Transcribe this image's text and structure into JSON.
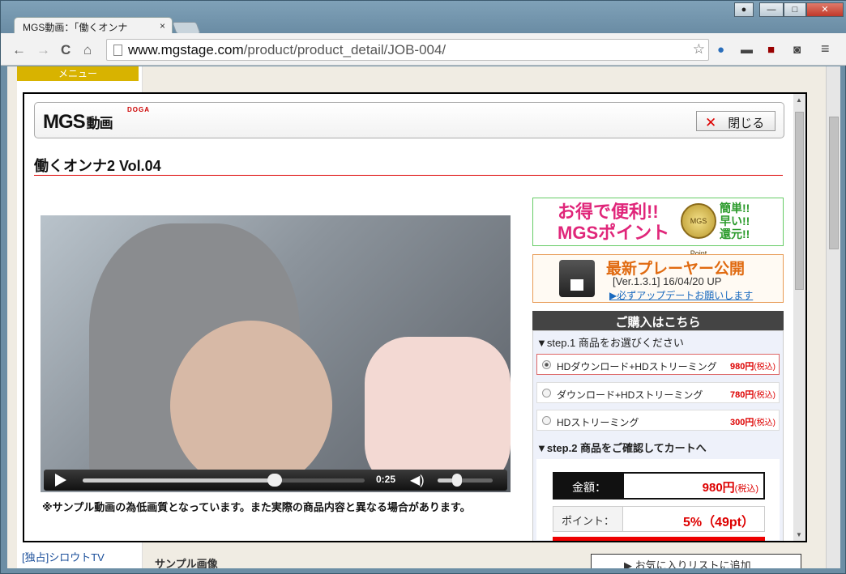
{
  "browser": {
    "tab_title": "MGS動画：「働くオンナ",
    "tab_close": "×",
    "url_host": "www.mgstage.com",
    "url_path": "/product/product_detail/JOB-004/",
    "back": "←",
    "forward": "→",
    "reload": "C",
    "home": "⌂",
    "minimize": "—",
    "maximize": "□",
    "close": "✕",
    "menu": "≡"
  },
  "background_page": {
    "menu_label": "メニュー",
    "sidebar_link": "[独占]シロウトTV",
    "sample_images": "サンプル画像",
    "favorite_btn": "▶ お気に入りリストに追加"
  },
  "modal": {
    "logo": "MGS",
    "logo_jp": "動画",
    "logo_doga": "DOGA",
    "close_label": "閉じる",
    "close_icon": "✕",
    "title": "働くオンナ2 Vol.04",
    "video": {
      "time": "0:25",
      "progress": 0.68,
      "volume": 0.35,
      "note": "※サンプル動画の為低画質となっています。また実際の商品内容と異なる場合があります。"
    },
    "banner_points": {
      "line1": "お得で便利!!",
      "line2": "MGSポイント",
      "coin": "MGS Point",
      "side1": "簡単!!",
      "side2": "早い!!",
      "side3": "還元!!"
    },
    "banner_player": {
      "title": "最新プレーヤー公開",
      "version": "[Ver.1.3.1]  16/04/20 UP",
      "link": "▶必ずアップデートお願いします"
    },
    "purchase": {
      "heading": "ご購入はこちら",
      "step1": "▼step.1 商品をお選びください",
      "options": [
        {
          "label": "HDダウンロード+HDストリーミング",
          "price": "980円",
          "tax": "(税込)",
          "selected": true
        },
        {
          "label": "ダウンロード+HDストリーミング",
          "price": "780円",
          "tax": "(税込)",
          "selected": false
        },
        {
          "label": "HDストリーミング",
          "price": "300円",
          "tax": "(税込)",
          "selected": false
        }
      ],
      "step2": "▼step.2 商品をご確認してカートへ",
      "amount_label": "金額：",
      "amount_value": "980円",
      "amount_tax": "(税込)",
      "points_label": "ポイント：",
      "points_value": "5%（49pt）"
    }
  }
}
